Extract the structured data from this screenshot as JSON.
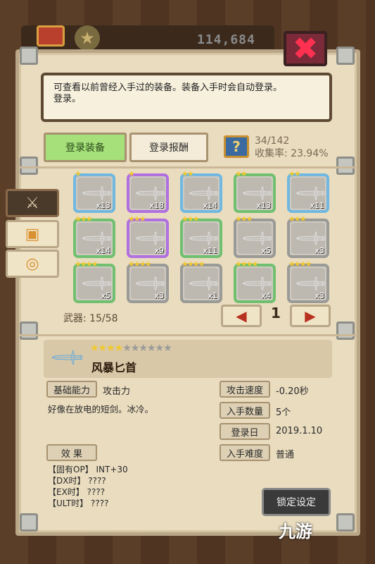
{
  "header": {
    "currency": "114,684",
    "close_icon": "close-x-icon"
  },
  "description": "可查看以前曾经入手过的装备。装备入手时会自动登录。\n登录。",
  "tabs": [
    {
      "label": "登录装备",
      "active": true
    },
    {
      "label": "登录报酬",
      "active": false
    }
  ],
  "collection": {
    "count": "34/142",
    "rate_label": "收集率:",
    "rate_value": "23.94%"
  },
  "side_tabs": [
    {
      "name": "weapon-tab",
      "icon": "sword-icon",
      "active": true
    },
    {
      "name": "armor-tab",
      "icon": "armor-icon",
      "active": false
    },
    {
      "name": "accessory-tab",
      "icon": "accessory-icon",
      "active": false
    }
  ],
  "grid": [
    {
      "stars": 1,
      "qty": "x13",
      "border": "blue"
    },
    {
      "stars": 1,
      "qty": "x18",
      "border": "purple"
    },
    {
      "stars": 2,
      "qty": "x14",
      "border": "blue"
    },
    {
      "stars": 2,
      "qty": "x13",
      "border": "green"
    },
    {
      "stars": 2,
      "qty": "x11",
      "border": "blue"
    },
    {
      "stars": 3,
      "qty": "x14",
      "border": "green"
    },
    {
      "stars": 3,
      "qty": "x9",
      "border": "purple"
    },
    {
      "stars": 3,
      "qty": "x11",
      "border": "green"
    },
    {
      "stars": 3,
      "qty": "x5",
      "border": "gray"
    },
    {
      "stars": 3,
      "qty": "x3",
      "border": "gray"
    },
    {
      "stars": 4,
      "qty": "x5",
      "border": "green"
    },
    {
      "stars": 4,
      "qty": "x3",
      "border": "gray"
    },
    {
      "stars": 4,
      "qty": "x1",
      "border": "gray"
    },
    {
      "stars": 4,
      "qty": "x4",
      "border": "green"
    },
    {
      "stars": 4,
      "qty": "x3",
      "border": "gray"
    }
  ],
  "weapon_count": "武器: 15/58",
  "pager": {
    "page": "1",
    "prev_icon": "arrow-left-icon",
    "next_icon": "arrow-right-icon"
  },
  "detail": {
    "stars_filled": 4,
    "stars_total": 10,
    "name": "风暴匕首",
    "base_label": "基础能力",
    "base_value": "攻击力",
    "flavor": "好像在放电的短剑。冰冷。",
    "speed_label": "攻击速度",
    "speed_value": "-0.20秒",
    "qty_label": "入手数量",
    "qty_value": "5个",
    "date_label": "登录日",
    "date_value": "2019.1.10",
    "difficulty_label": "入手难度",
    "difficulty_value": "普通",
    "effect_label": "效 果",
    "effects": [
      "【固有OP】 INT+30",
      "【DX时】 ????",
      "【EX时】 ????",
      "【ULT时】 ????"
    ]
  },
  "lock_button": "锁定设定",
  "watermark": "九游"
}
